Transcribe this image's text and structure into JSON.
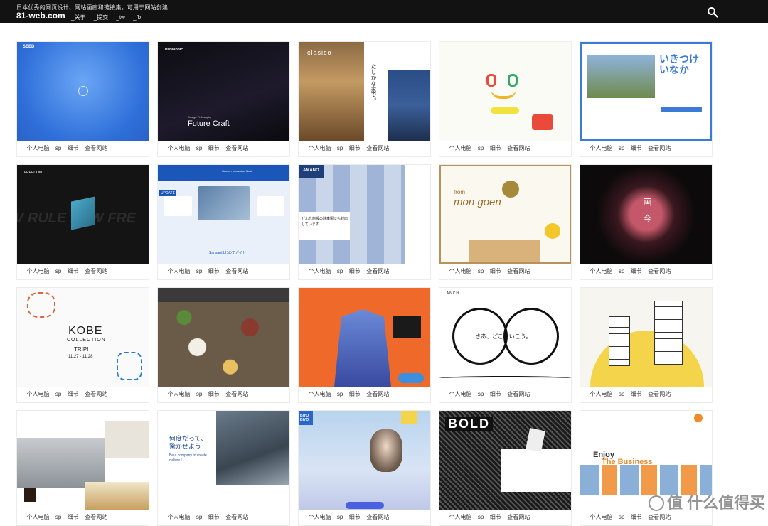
{
  "header": {
    "tagline": "日本优秀的网页设计、网站画廊和链接集。可用于网站创建",
    "logo": "81-web.com",
    "nav": [
      "_关于",
      "_提交",
      "_tw",
      "_fb"
    ]
  },
  "card_links": [
    "_个人电脑",
    "_sp",
    "_细节",
    "_查看网站"
  ],
  "thumb_texts": {
    "seed": "SEED",
    "panasonic": "Panasonic",
    "future_craft": "Future Craft",
    "design_philosophy": "Design Philosophy",
    "clasico": "clasico",
    "tashikana": "たしかな家で。",
    "ikitsuke": "いきつけ いなか",
    "freedom": "FREEDOM",
    "rule_new": "V RULE NEW FRE",
    "senaeri": "Sensen Innovation Nest",
    "update": "UPDATE",
    "sansanhajime": "Sansanはじめてガイド",
    "amano": "AMANO",
    "amano_sub": "どんな施設の駐車場にも対応しています",
    "from_mon": "from",
    "mongoen": "mon goen",
    "kaikon": "画 今",
    "kobe": "KOBE",
    "kobe_coll": "COLLECTION",
    "trip": "TRIP!",
    "kobe_date": "11.27 - 11.28",
    "lanch": "LANCH",
    "sao_doko": "さあ、どこにいこう。",
    "nanido": "何度だって、驚かせよう",
    "create_culture": "Be a company to create culture !",
    "bold": "BOLD",
    "enjoy": "Enjoy",
    "business": "The Business",
    "biyo": "BIYO BIYO"
  },
  "watermark": "值 什么值得买",
  "colors": {
    "topbar": "#121212",
    "seed_blue": "#3a7be0",
    "orange": "#ef6a2a",
    "yellow": "#f4d44a",
    "dark": "#1a1a1a"
  }
}
